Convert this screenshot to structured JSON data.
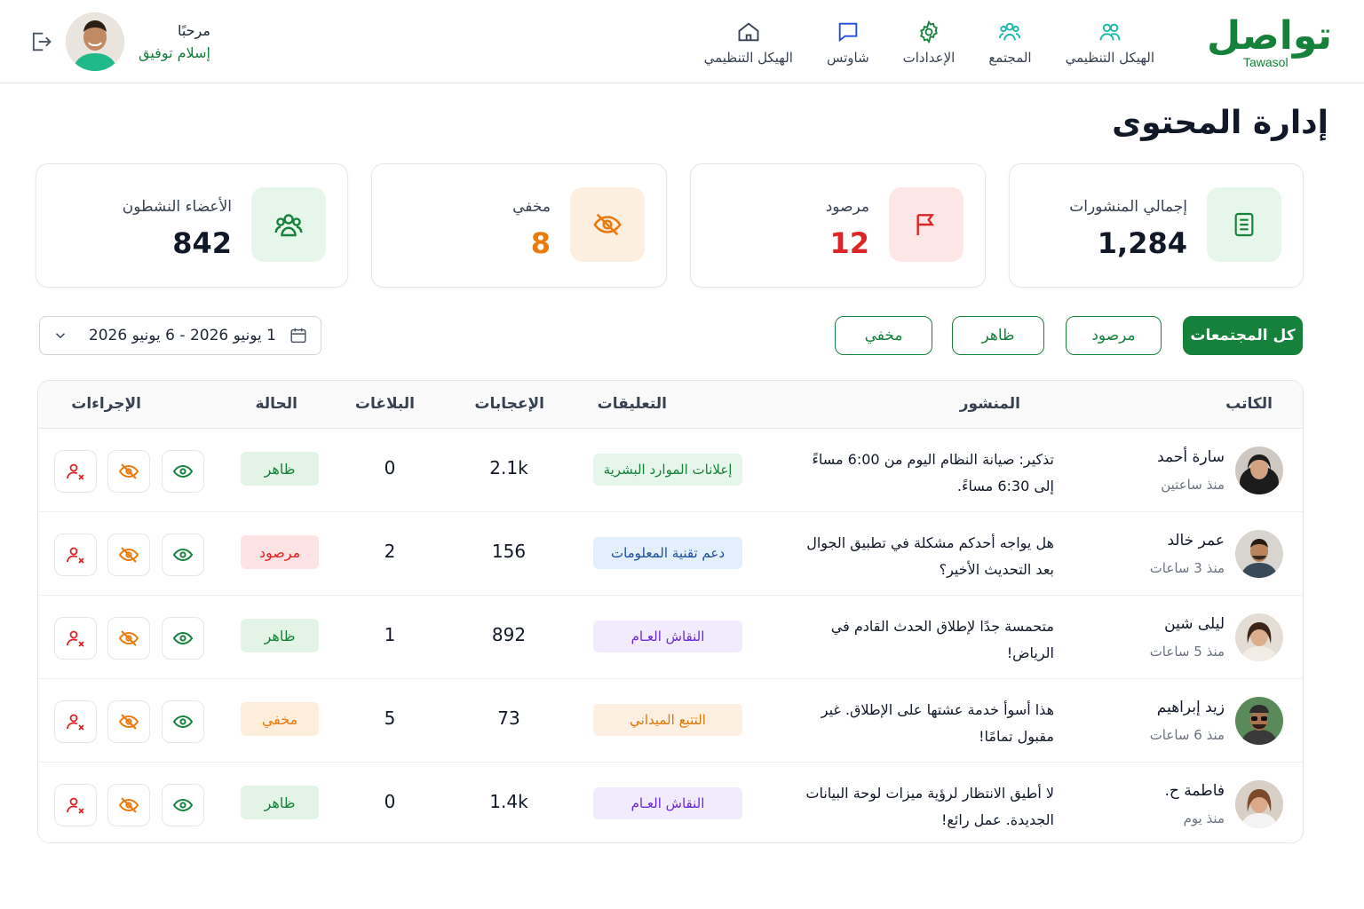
{
  "brand": {
    "name_ar": "تواصل",
    "name_en": "Tawasol",
    "color": "#16813a"
  },
  "nav": [
    {
      "label": "الهيكل التنظيمي",
      "icon": "users-icon"
    },
    {
      "label": "المجتمع",
      "icon": "community-icon"
    },
    {
      "label": "الإعدادات",
      "icon": "gear-icon"
    },
    {
      "label": "شاوتس",
      "icon": "chat-icon"
    },
    {
      "label": "الهيكل التنظيمي",
      "icon": "home-icon"
    }
  ],
  "user": {
    "greeting": "مرحبًا",
    "name": "إسلام توفيق"
  },
  "page": {
    "title": "إدارة المحتوى"
  },
  "stats": [
    {
      "label": "إجمالي المنشورات",
      "value": "1,284",
      "icon": "document-icon",
      "color": "#111827"
    },
    {
      "label": "مرصود",
      "value": "12",
      "icon": "flag-icon",
      "color": "#dc2626"
    },
    {
      "label": "مخفي",
      "value": "8",
      "icon": "eye-off-icon",
      "color": "#ea7a0c"
    },
    {
      "label": "الأعضاء النشطون",
      "value": "842",
      "icon": "users-icon",
      "color": "#111827"
    }
  ],
  "filters": {
    "all": "كل المجتمعات",
    "flagged": "مرصود",
    "visible": "ظاهر",
    "hidden": "مخفي"
  },
  "date_range": "1 يونيو 2026 - 6 يونيو 2026",
  "table": {
    "headers": {
      "author": "الكاتب",
      "post": "المنشور",
      "comments": "التعليقات",
      "likes": "الإعجابات",
      "reports": "البلاغات",
      "status": "الحالة",
      "actions": "الإجراءات"
    },
    "rows": [
      {
        "author": "سارة أحمد",
        "time": "منذ ساعتين",
        "post": "تذكير: صيانة النظام اليوم من 6:00 مساءً إلى 6:30 مساءً.",
        "tag": "إعلانات الموارد البشرية",
        "tag_color": "green",
        "likes": "2.1k",
        "reports": "0",
        "status": "ظاهر",
        "status_color": "green"
      },
      {
        "author": "عمر خالد",
        "time": "منذ 3 ساعات",
        "post": "هل يواجه أحدكم مشكلة في تطبيق الجوال بعد التحديث الأخير؟",
        "tag": "دعم تقنية المعلومات",
        "tag_color": "blue",
        "likes": "156",
        "reports": "2",
        "status": "مرصود",
        "status_color": "red"
      },
      {
        "author": "ليلى شين",
        "time": "منذ 5 ساعات",
        "post": "متحمسة جدًا لإطلاق الحدث القادم في الرياض!",
        "tag": "النقاش العـام",
        "tag_color": "purple",
        "likes": "892",
        "reports": "1",
        "status": "ظاهر",
        "status_color": "green"
      },
      {
        "author": "زيد إبراهيم",
        "time": "منذ 6 ساعات",
        "post": "هذا أسوأ خدمة عشتها على الإطلاق. غير مقبول تمامًا!",
        "tag": "التتبع الميداني",
        "tag_color": "orange",
        "likes": "73",
        "reports": "5",
        "status": "مخفي",
        "status_color": "orange"
      },
      {
        "author": "فاطمة ح.",
        "time": "منذ يوم",
        "post": "لا أطيق الانتظار لرؤية ميزات لوحة البيانات الجديدة. عمل رائع!",
        "tag": "النقاش العـام",
        "tag_color": "purple",
        "likes": "1.4k",
        "reports": "0",
        "status": "ظاهر",
        "status_color": "green"
      }
    ]
  }
}
